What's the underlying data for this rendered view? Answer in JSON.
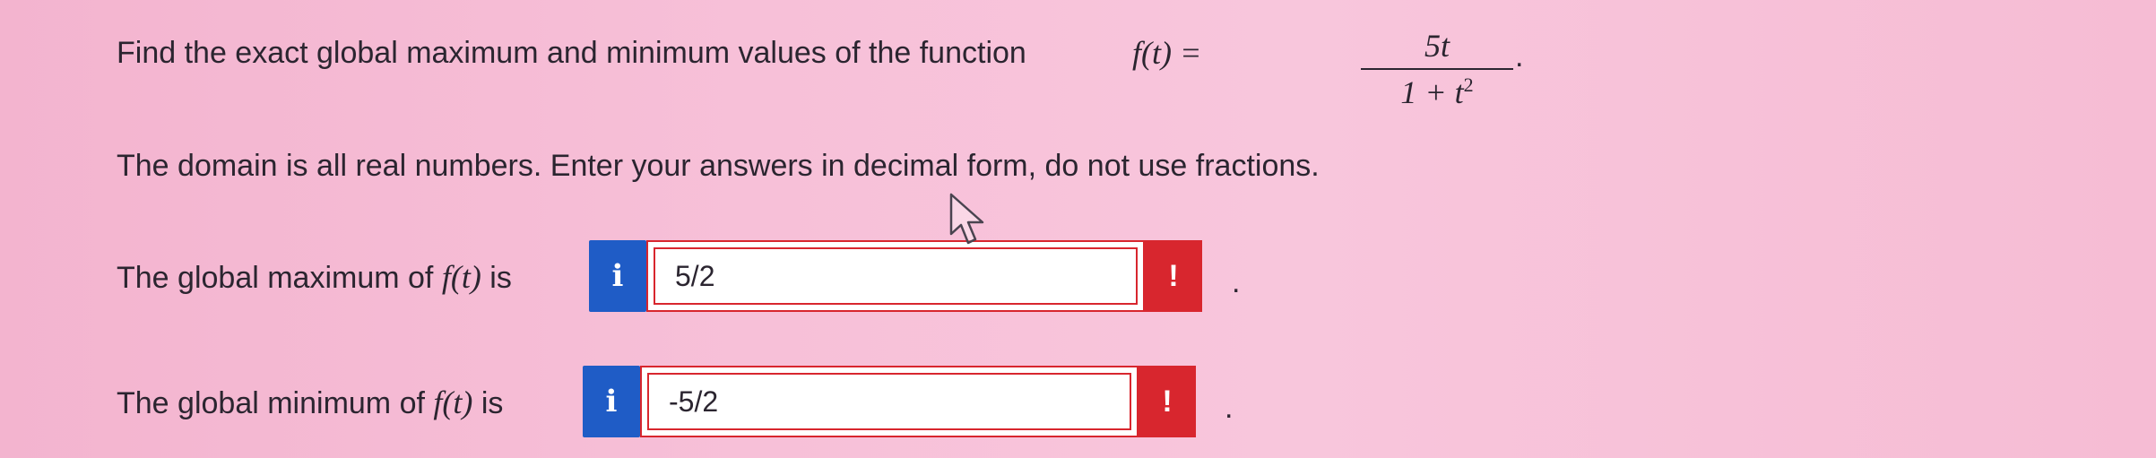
{
  "question": {
    "lead_text": "Find the exact global maximum and minimum values of the function",
    "function_lhs": "f(t) =",
    "numerator": "5t",
    "denominator_base": "1  + t",
    "denominator_exponent": "2",
    "end_period": ".",
    "domain_text": "The domain is all real numbers. Enter your answers in decimal form, do not use fractions."
  },
  "answers": {
    "max": {
      "label_prefix": "The global maximum of",
      "label_fn": "f(t)",
      "label_suffix": "is",
      "value": "5/2",
      "info_glyph": "i",
      "alert_glyph": "!",
      "trailing": "."
    },
    "min": {
      "label_prefix": "The global minimum of",
      "label_fn": "f(t)",
      "label_suffix": "is",
      "value": "-5/2",
      "info_glyph": "i",
      "alert_glyph": "!",
      "trailing": "."
    }
  },
  "icons": {
    "info": "info-icon",
    "alert": "exclamation-icon",
    "cursor": "mouse-pointer-icon"
  },
  "colors": {
    "background": "#f7c0d8",
    "info_button": "#1f5cc6",
    "error": "#d8262e",
    "text": "#2b2530"
  }
}
